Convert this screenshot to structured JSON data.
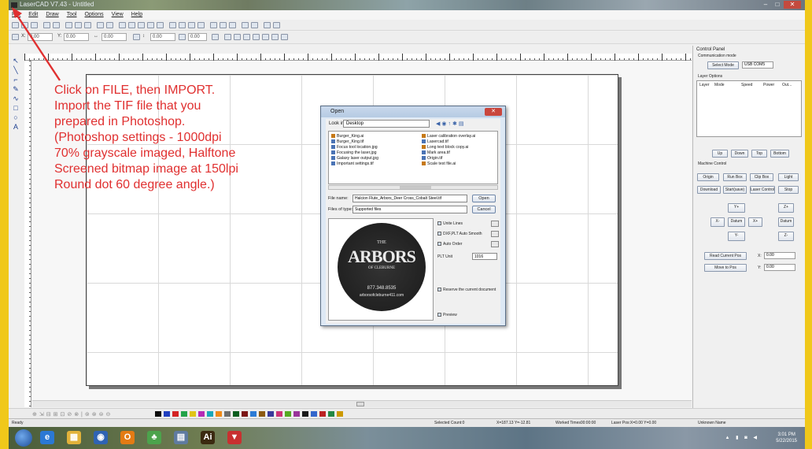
{
  "window": {
    "title": "LaserCAD V7.43 - Untitled"
  },
  "menu": [
    "File",
    "Edit",
    "Draw",
    "Tool",
    "Options",
    "View",
    "Help"
  ],
  "toolbar2": {
    "x_label": "X:",
    "x_value": "0.00",
    "y_label": "Y:",
    "y_value": "0.00",
    "w_value": "0.00",
    "h_value": "0.00",
    "zoom_value": "0.00",
    "angle_value": "0.00"
  },
  "annotation": {
    "color": "#e03030",
    "lines": [
      "Click on FILE, then IMPORT.",
      "Import the TIF file that you",
      "prepared in Photoshop.",
      "(Photoshop settings - 1000dpi",
      "70% grayscale imaged, Halftone",
      "Screened bitmap image at 150lpi",
      "Round dot 60 degree angle.)"
    ]
  },
  "open_dialog": {
    "title": "Open",
    "look_in_label": "Look in:",
    "look_in_value": "Desktop",
    "files_left": [
      {
        "name": "Burger_King.ai",
        "type": "ai"
      },
      {
        "name": "Burger_King.tif",
        "type": "tif"
      },
      {
        "name": "Focus tool location.jpg",
        "type": "img"
      },
      {
        "name": "Focusing the laser.jpg",
        "type": "img"
      },
      {
        "name": "Galaxy laser output.jpg",
        "type": "img"
      },
      {
        "name": "Important settings.tif",
        "type": "tif"
      }
    ],
    "files_right": [
      {
        "name": "Laser calibration overlay.ai",
        "type": "ai"
      },
      {
        "name": "Lasercad.tif",
        "type": "tif"
      },
      {
        "name": "Long text block copy.ai",
        "type": "ai"
      },
      {
        "name": "Mark area.tif",
        "type": "tif"
      },
      {
        "name": "Origin.tif",
        "type": "tif"
      },
      {
        "name": "Scale test file.ai",
        "type": "ai"
      }
    ],
    "file_name_label": "File name:",
    "file_name_value": "Halcion Flute_Arbors_Deer Cross_Cobalt Steel.tif",
    "files_of_type_label": "Files of type:",
    "files_of_type_value": "Supported files",
    "open_button": "Open",
    "cancel_button": "Cancel",
    "preview": {
      "logo_top": "THE",
      "logo_main": "ARBORS",
      "logo_sub": "OF CLEBURNE",
      "phone": "877.348.8535",
      "web": "arborsofcleburne411.com"
    },
    "options": {
      "unite_lines": "Unite Lines",
      "dxf_auto_smooth": "DXF,PLT Auto Smooth",
      "auto_order": "Auto Order",
      "plt_unit_label": "PLT Unit",
      "plt_unit_value": "1016",
      "reserve_doc": "Reserve the current document",
      "preview": "Preview"
    }
  },
  "control_panel": {
    "title": "Control Panel",
    "comm_mode_label": "Communication mode",
    "select_mode": "Select Mode",
    "usb_value": "USB COM5",
    "layer_options_label": "Layer Options",
    "layer_columns": [
      "Layer",
      "Mode",
      "Speed",
      "Power",
      "Out..."
    ],
    "layer_buttons": [
      "Up",
      "Down",
      "Top",
      "Bottom"
    ],
    "machine_control_label": "Machine Control",
    "machine_row1": [
      "Origin",
      "Run Box",
      "Clip Box",
      "Light"
    ],
    "machine_row2": [
      "Download",
      "Start(save)",
      "Laser Control",
      "Stop"
    ],
    "jog": {
      "y_plus": "Y+",
      "z_plus": "Z+",
      "x_minus": "X-",
      "datum": "Datum",
      "x_plus": "X+",
      "z_datum": "Datum",
      "y_minus": "Y-",
      "z_minus": "Z-"
    },
    "read_current_pos": "Read Current Pos",
    "move_to_pos": "Move to Pos",
    "x_pos_label": "X:",
    "x_pos_value": "0.00",
    "y_pos_label": "Y:",
    "y_pos_value": "0.00"
  },
  "palette_colors": [
    "#0a0a0a",
    "#1f3fbf",
    "#d42323",
    "#22a34a",
    "#e0c416",
    "#b52bb5",
    "#1aa7b8",
    "#f08a18",
    "#6e6e6e",
    "#0b5c1e",
    "#7b1515",
    "#2c7bd6",
    "#8c5a12",
    "#3a3a9a",
    "#cc3377",
    "#55aa22",
    "#993399",
    "#1a1a1a",
    "#3366cc",
    "#bb2222",
    "#228844",
    "#cc9900"
  ],
  "status": {
    "left": "Ready",
    "selected": "Selected Count:0",
    "coords": "X=187.13 Y=-12.81",
    "worked": "Worked Times00:00:00",
    "laser_pos": "Laser Pos:X=0.00 Y=0.00",
    "device": "Unknown Name"
  },
  "taskbar": {
    "time": "3:01 PM",
    "date": "5/22/2015",
    "apps": [
      {
        "name": "ie",
        "glyph": "e",
        "color": "#2b78d4"
      },
      {
        "name": "explorer",
        "glyph": "▦",
        "color": "#e2b23a"
      },
      {
        "name": "media",
        "glyph": "◉",
        "color": "#2f63b3"
      },
      {
        "name": "outlook",
        "glyph": "O",
        "color": "#e37b14"
      },
      {
        "name": "misc",
        "glyph": "♣",
        "color": "#4ca34c"
      },
      {
        "name": "docs",
        "glyph": "▤",
        "color": "#5f7ba0"
      },
      {
        "name": "illustrator",
        "glyph": "Ai",
        "color": "#3b2a10"
      },
      {
        "name": "lasercad",
        "glyph": "▼",
        "color": "#c83030"
      }
    ]
  }
}
